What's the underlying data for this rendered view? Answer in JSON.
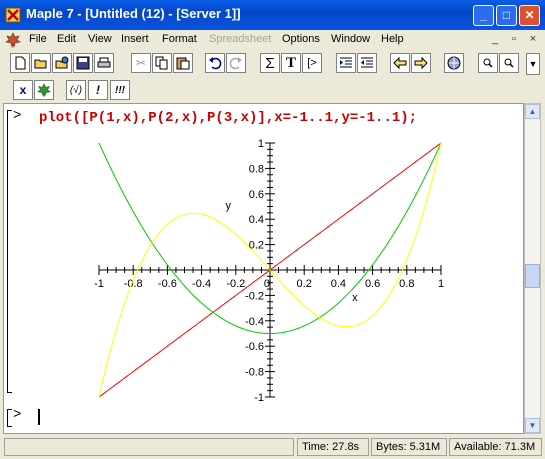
{
  "window": {
    "title": "Maple 7  - [Untitled (12) - [Server 1]]",
    "minimize": "_",
    "maximize": "□",
    "close": "✕"
  },
  "menubar": {
    "items": [
      "File",
      "Edit",
      "View",
      "Insert",
      "Format",
      "Spreadsheet",
      "Options",
      "Window",
      "Help"
    ],
    "disabled": [
      "Spreadsheet"
    ],
    "mdi_minimize": "_",
    "mdi_restore": "🗗",
    "mdi_close": "×"
  },
  "toolbar": {
    "icons": [
      "new-icon",
      "open-icon",
      "open-url-icon",
      "save-icon",
      "print-icon",
      "cut-icon",
      "copy-icon",
      "paste-icon",
      "undo-icon",
      "redo-icon",
      "sum-icon",
      "text-icon",
      "prompt-icon",
      "indent-icon",
      "outdent-icon",
      "back-icon",
      "forward-icon",
      "stop-icon",
      "zoom-in-icon",
      "zoom-out-icon"
    ],
    "sum_label": "Σ",
    "text_label": "T",
    "prompt_label": "[>"
  },
  "toolbar2": {
    "x_label": "x",
    "check_label": "(√)",
    "exec_label": "!",
    "exec_all_label": "!!!"
  },
  "worksheet": {
    "prompt": "[>",
    "command": "plot([P(1,x),P(2,x),P(3,x)],x=-1..1,y=-1..1);",
    "empty_prompt": "[>"
  },
  "chart_data": {
    "type": "line",
    "title": "",
    "xlabel": "x",
    "ylabel": "y",
    "xlim": [
      -1,
      1
    ],
    "ylim": [
      -1,
      1
    ],
    "x_ticks": [
      "-1",
      "-0.8",
      "-0.6",
      "-0.4",
      "-0.2",
      "0",
      "0.2",
      "0.4",
      "0.6",
      "0.8",
      "1"
    ],
    "y_ticks": [
      "1",
      "0.8",
      "0.6",
      "0.4",
      "0.2",
      "-0.2",
      "-0.4",
      "-0.6",
      "-0.8",
      "-1"
    ],
    "series": [
      {
        "function": "P(1,x) = x",
        "color": "#ff0000"
      },
      {
        "function": "P(2,x) = (3x^2-1)/2",
        "color": "#00cc00"
      },
      {
        "function": "P(3,x) = (5x^3-3x)/2",
        "color": "#ffff00"
      }
    ]
  },
  "status": {
    "time": "Time:  27.8s",
    "bytes": "Bytes: 5.31M",
    "available": "Available: 71.3M"
  }
}
